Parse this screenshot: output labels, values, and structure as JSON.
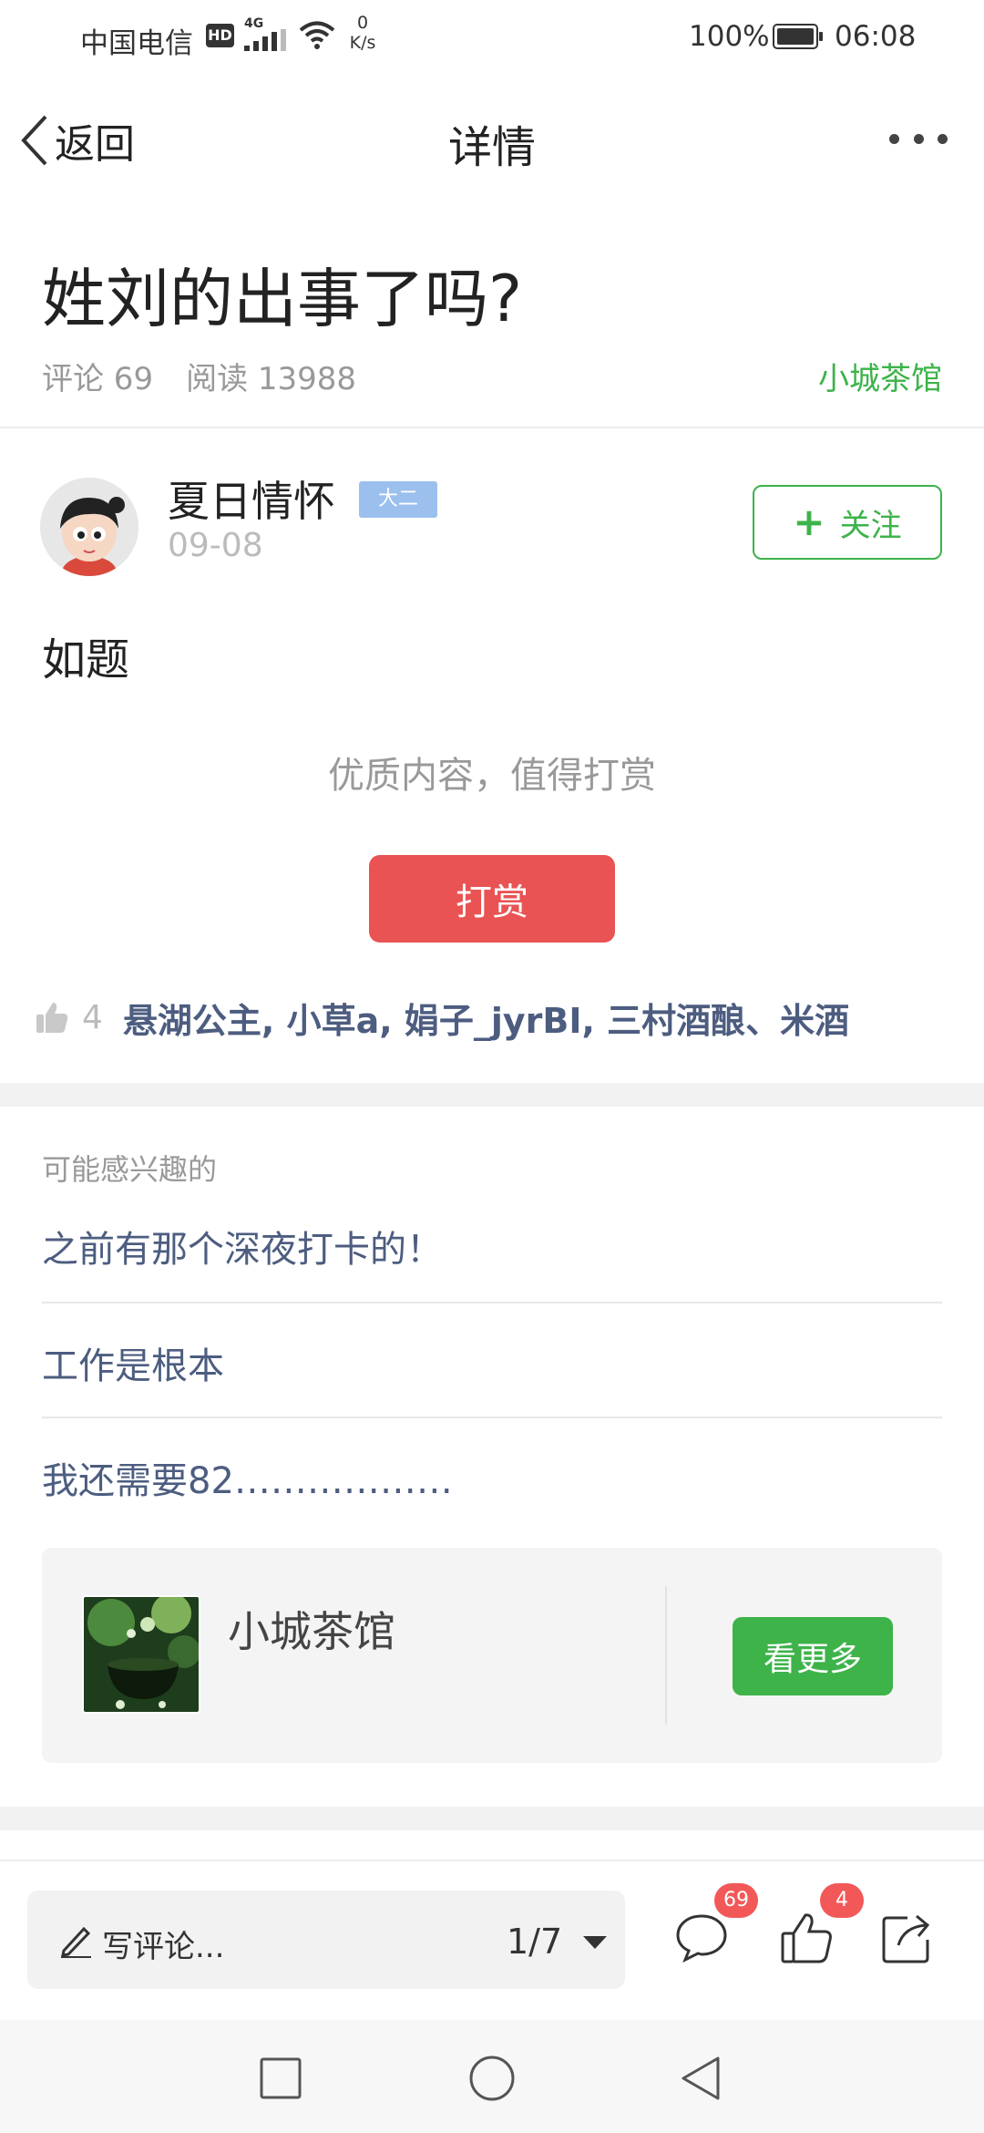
{
  "status_bar": {
    "carrier": "中国电信",
    "hd": "HD",
    "network_type": "4G",
    "net_speed_value": "0",
    "net_speed_unit": "K/s",
    "battery": "100%",
    "time": "06:08"
  },
  "nav": {
    "back_label": "返回",
    "title": "详情"
  },
  "post": {
    "title": "姓刘的出事了吗?",
    "comments_label": "评论 69",
    "reads_label": "阅读 13988",
    "group": "小城茶馆",
    "author": {
      "name": "夏日情怀",
      "tag": "大二",
      "date": "09-08",
      "follow_label": "关注"
    },
    "body": "如题",
    "reward_prompt": "优质内容，值得打赏",
    "reward_button": "打赏",
    "likes_count": "4",
    "likes_names": "悬湖公主, 小草a, 娟子_jyrBI, 三村酒酿、米酒"
  },
  "recommendations": {
    "label": "可能感兴趣的",
    "items": [
      "之前有那个深夜打卡的！",
      "工作是根本",
      "我还需要82………………"
    ]
  },
  "group_card": {
    "name": "小城茶馆",
    "see_more": "看更多"
  },
  "comment_bar": {
    "placeholder": "写评论...",
    "page_indicator": "1/7",
    "comment_badge": "69",
    "like_badge": "4"
  },
  "colors": {
    "accent_green": "#3db34a",
    "reward_red": "#e95353",
    "link_blue": "#4d5d80",
    "badge_red": "#f25858"
  }
}
